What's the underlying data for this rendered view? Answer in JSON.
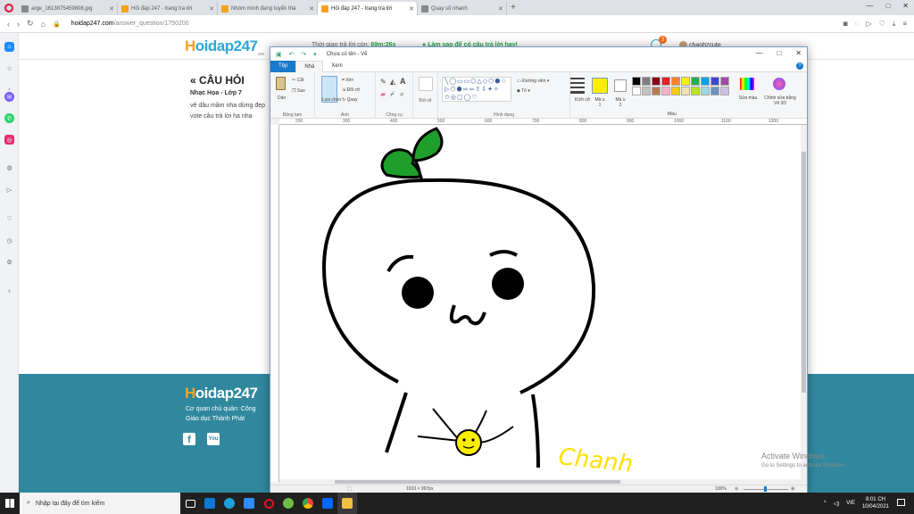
{
  "browser": {
    "tabs": [
      {
        "label": "arge_1613875459808.jpg",
        "favicon_color": "#888888"
      },
      {
        "label": "Hỏi đáp 247 - trang tra lời",
        "favicon_color": "#f7a31b"
      },
      {
        "label": "Nhóm mình đang tuyển thà",
        "favicon_color": "#f7a31b"
      },
      {
        "label": "Hỏi đáp 247 - trang tra lời",
        "favicon_color": "#f7a31b",
        "active": true
      },
      {
        "label": "Quay số nhanh",
        "favicon_color": "#888888"
      }
    ],
    "url_host": "hoidap247.com",
    "url_path": "/answer_question/1750200",
    "new_tab": "+",
    "window_controls": [
      "—",
      "□",
      "✕"
    ]
  },
  "site": {
    "logo": "oidap247",
    "logo_h": "H",
    "logo_com": ".com",
    "time_left_label": "Thời gian trả lời còn:",
    "time_left_value": "69m:26s",
    "howto": "Làm sao để có câu trả lời hay!",
    "notif_count": "3",
    "username": "chanhzcute",
    "question_title": "« CÂU HỎI",
    "question_subject": "Nhạc Họa - Lớp 7",
    "question_body": "vẽ dâu mầm nha dừng đẹp vote câu trả lời ha nha",
    "footer_logo": "oidap247",
    "footer_text": "Cơ quan chủ quản: Công Giáo dục Thành Phát",
    "facebook": "f",
    "youtube": "You"
  },
  "paint": {
    "title": "Chưa có tên - Vẽ",
    "tabs": [
      "Tệp",
      "Nhà",
      "Xem"
    ],
    "groups": {
      "clipboard": {
        "label": "Bảng tạm",
        "paste": "Dán",
        "cut": "Cắt",
        "copy": "Sao"
      },
      "image": {
        "label": "Ảnh",
        "select": "Lựa chọn",
        "crop": "Xén",
        "resize": "Đổi cỡ",
        "rotate": "Quay"
      },
      "tools": {
        "label": "Công cụ"
      },
      "brushes": {
        "label": "Bút vẽ"
      },
      "shapes": {
        "label": "Hình dạng",
        "outline": "Đường viền",
        "fill": "Tô"
      },
      "size": {
        "label": "Kích cỡ"
      },
      "colors": {
        "label": "Màu",
        "color1": "Mà u 1",
        "color2": "Mà u 2",
        "edit": "Sửa màu",
        "edit3d": "Chỉnh sửa bằng Vẽ 3D"
      }
    },
    "ruler": [
      "200",
      "300",
      "400",
      "500",
      "600",
      "700",
      "800",
      "900",
      "1000",
      "1100",
      "1200"
    ],
    "palette": [
      "#000000",
      "#7f7f7f",
      "#880015",
      "#ed1c24",
      "#ff7f27",
      "#fff200",
      "#22b14c",
      "#00a2e8",
      "#3f48cc",
      "#a349a4",
      "#ffffff",
      "#c3c3c3",
      "#b97a57",
      "#ffaec9",
      "#ffc90e",
      "#efe4b0",
      "#b5e61d",
      "#99d9ea",
      "#7092be",
      "#c8bfe7"
    ],
    "color1": "#ffee00",
    "status_size": "1910 × 997px",
    "zoom": "100%",
    "signature": "Chanh",
    "sprout_color": "#1e9e2a",
    "bead_color": "#ffee00"
  },
  "watermark": {
    "line1": "Activate Windows",
    "line2": "Go to Settings to activate Windows."
  },
  "taskbar": {
    "search": "Nhập tại đây để tìm kiếm",
    "time": "8:01 CH",
    "date": "10/04/2021",
    "lang": "VIE"
  }
}
